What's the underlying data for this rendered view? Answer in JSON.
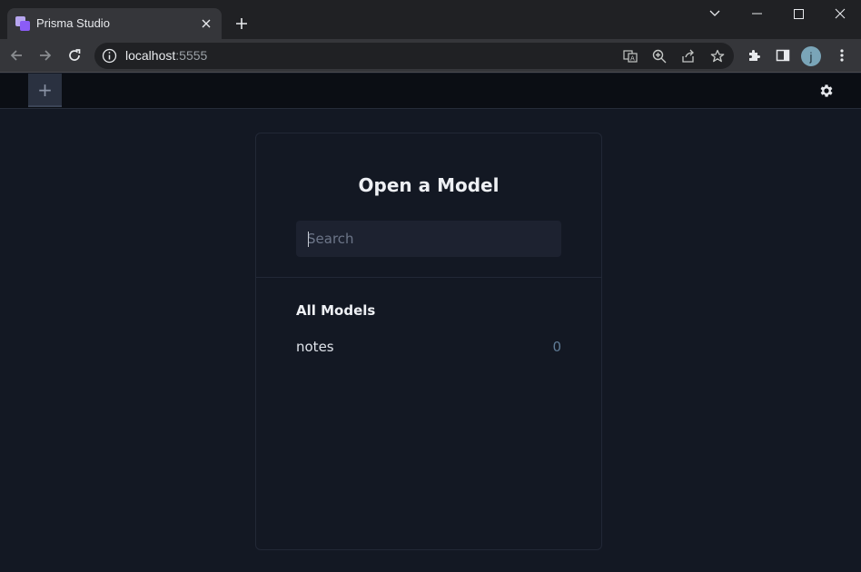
{
  "browser": {
    "tab_title": "Prisma Studio",
    "url_host": "localhost",
    "url_port": ":5555",
    "profile_initial": "j"
  },
  "app": {
    "add_tab_label": "+"
  },
  "panel": {
    "title": "Open a Model",
    "search_placeholder": "Search",
    "section_title": "All Models",
    "models": [
      {
        "name": "notes",
        "count": "0"
      }
    ]
  }
}
